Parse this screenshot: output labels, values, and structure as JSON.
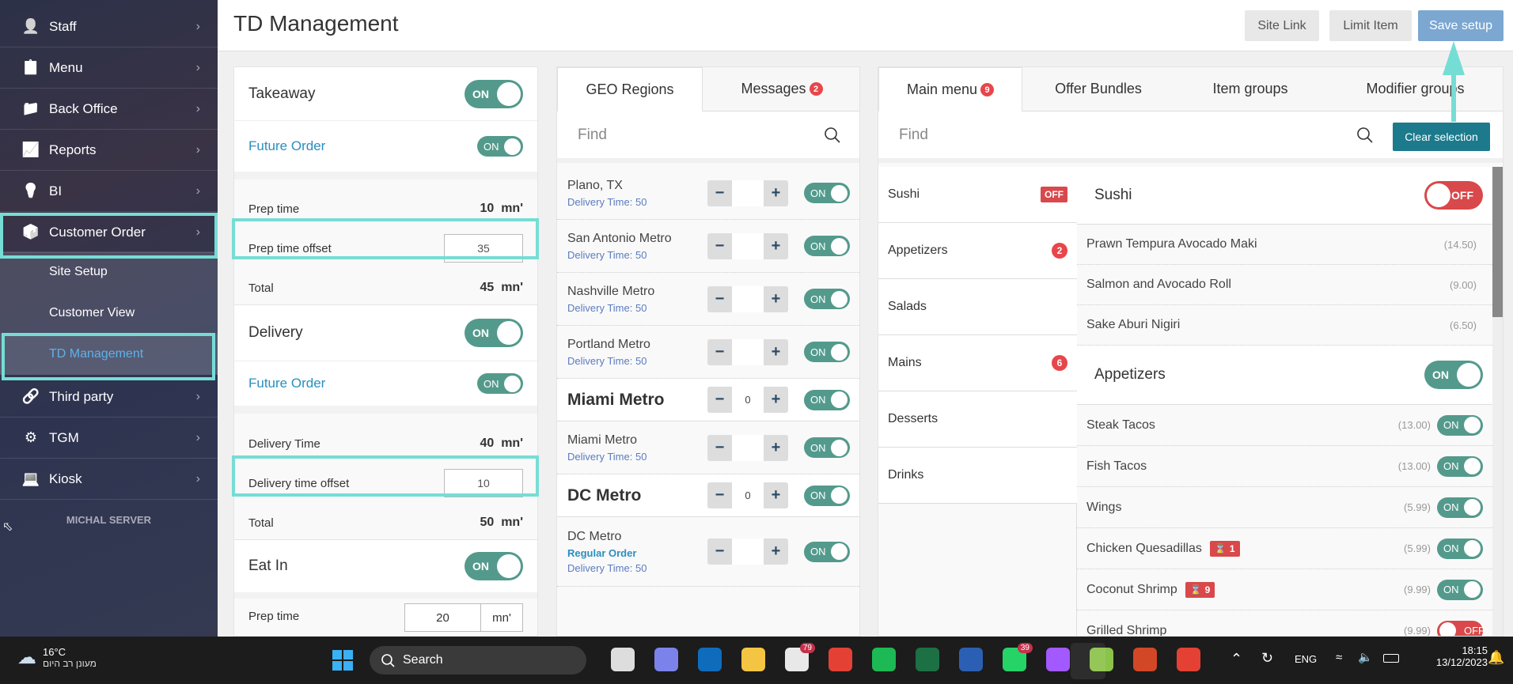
{
  "sidebar": {
    "items": [
      {
        "label": "Staff",
        "icon": "staff-icon"
      },
      {
        "label": "Menu",
        "icon": "menu-icon"
      },
      {
        "label": "Back Office",
        "icon": "back-office-icon"
      },
      {
        "label": "Reports",
        "icon": "reports-icon"
      },
      {
        "label": "BI",
        "icon": "lightbulb-icon"
      },
      {
        "label": "Customer Order",
        "icon": "customer-order-icon"
      }
    ],
    "sub_items": [
      {
        "label": "Site Setup"
      },
      {
        "label": "Customer View"
      },
      {
        "label": "TD Management",
        "active": true
      }
    ],
    "items_after": [
      {
        "label": "Third party",
        "icon": "link-icon"
      },
      {
        "label": "TGM",
        "icon": "gear-icon"
      },
      {
        "label": "Kiosk",
        "icon": "kiosk-icon"
      }
    ],
    "server_label": "MICHAL SERVER"
  },
  "header": {
    "title": "TD Management",
    "buttons": {
      "site_link": "Site Link",
      "limit_item": "Limit Item",
      "save_setup": "Save setup"
    }
  },
  "settings": {
    "takeaway": {
      "label": "Takeaway",
      "toggle": "ON",
      "future_order": "Future Order",
      "future_toggle": "ON",
      "prep_time_label": "Prep time",
      "prep_time": "10",
      "unit": "mn'",
      "offset_label": "Prep time offset",
      "offset": "35",
      "total_label": "Total",
      "total": "45"
    },
    "delivery": {
      "label": "Delivery",
      "toggle": "ON",
      "future_order": "Future Order",
      "future_toggle": "ON",
      "time_label": "Delivery Time",
      "time": "40",
      "unit": "mn'",
      "offset_label": "Delivery time offset",
      "offset": "10",
      "total_label": "Total",
      "total": "50"
    },
    "eat_in": {
      "label": "Eat In",
      "toggle": "ON",
      "prep_time_label": "Prep time",
      "prep_time": "20",
      "unit": "mn'"
    }
  },
  "geo": {
    "tabs": [
      {
        "label": "GEO Regions"
      },
      {
        "label": "Messages",
        "badge": "2"
      }
    ],
    "find_placeholder": "Find",
    "rows": [
      {
        "name": "Plano, TX",
        "delivery": "Delivery Time: 50",
        "value": "",
        "toggle": "ON"
      },
      {
        "name": "San Antonio Metro",
        "delivery": "Delivery Time: 50",
        "value": "",
        "toggle": "ON"
      },
      {
        "name": "Nashville Metro",
        "delivery": "Delivery Time: 50",
        "value": "",
        "toggle": "ON"
      },
      {
        "name": "Portland Metro",
        "delivery": "Delivery Time: 50",
        "value": "",
        "toggle": "ON"
      },
      {
        "name": "Miami Metro",
        "group": true,
        "value": "0",
        "toggle": "ON"
      },
      {
        "name": "Miami Metro",
        "delivery": "Delivery Time: 50",
        "value": "",
        "toggle": "ON"
      },
      {
        "name": "DC Metro",
        "group": true,
        "value": "0",
        "toggle": "ON"
      },
      {
        "name": "DC Metro",
        "order_type": "Regular Order",
        "delivery": "Delivery Time: 50",
        "value": "",
        "toggle": "ON"
      }
    ]
  },
  "menu": {
    "tabs": [
      {
        "label": "Main menu",
        "badge": "9"
      },
      {
        "label": "Offer Bundles"
      },
      {
        "label": "Item groups"
      },
      {
        "label": "Modifier groups"
      }
    ],
    "find_placeholder": "Find",
    "clear_selection": "Clear selection",
    "categories": [
      {
        "name": "Sushi",
        "badge": "OFF"
      },
      {
        "name": "Appetizers",
        "count": "2"
      },
      {
        "name": "Salads"
      },
      {
        "name": "Mains",
        "count": "6"
      },
      {
        "name": "Desserts"
      },
      {
        "name": "Drinks"
      }
    ],
    "groups": [
      {
        "name": "Sushi",
        "toggle": "OFF",
        "items": [
          {
            "name": "Prawn Tempura Avocado Maki",
            "price": "(14.50)"
          },
          {
            "name": "Salmon and Avocado Roll",
            "price": "(9.00)"
          },
          {
            "name": "Sake Aburi Nigiri",
            "price": "(6.50)"
          }
        ]
      },
      {
        "name": "Appetizers",
        "toggle": "ON",
        "items": [
          {
            "name": "Steak Tacos",
            "price": "(13.00)",
            "toggle": "ON"
          },
          {
            "name": "Fish Tacos",
            "price": "(13.00)",
            "toggle": "ON"
          },
          {
            "name": "Wings",
            "price": "(5.99)",
            "toggle": "ON"
          },
          {
            "name": "Chicken Quesadillas",
            "limit": "1",
            "price": "(5.99)",
            "toggle": "ON"
          },
          {
            "name": "Coconut Shrimp",
            "limit": "9",
            "price": "(9.99)",
            "toggle": "ON"
          },
          {
            "name": "Grilled Shrimp",
            "price": "(9.99)",
            "toggle": "OFF"
          }
        ]
      }
    ]
  },
  "taskbar": {
    "weather": {
      "temp": "16°C",
      "desc": "מעונן רב היום"
    },
    "search": "Search",
    "apps": [
      {
        "name": "task-view",
        "color": "#ddd"
      },
      {
        "name": "teams",
        "color": "#7b83eb"
      },
      {
        "name": "outlook",
        "color": "#0f6cbd"
      },
      {
        "name": "file-explorer",
        "color": "#f4c542"
      },
      {
        "name": "slack",
        "color": "#e8e8e8",
        "badge": "79"
      },
      {
        "name": "chrome",
        "color": "#e44134"
      },
      {
        "name": "spotify",
        "color": "#1db954"
      },
      {
        "name": "excel",
        "color": "#1d7044"
      },
      {
        "name": "word",
        "color": "#2b5fb4"
      },
      {
        "name": "whatsapp",
        "color": "#25d366",
        "badge": "39"
      },
      {
        "name": "figma",
        "color": "#a259ff"
      },
      {
        "name": "app-green",
        "color": "#8bc34a"
      },
      {
        "name": "powerpoint",
        "color": "#d24726"
      },
      {
        "name": "chrome-2",
        "color": "#e44134"
      }
    ],
    "lang": "ENG",
    "time": "18:15",
    "date": "13/12/2023"
  },
  "colors": {
    "toggle_on": "#539a8c",
    "toggle_off": "#d9484b",
    "highlight": "#76ddd5",
    "clear_btn": "#1c7a8c",
    "save_btn": "#7ba7d1"
  }
}
